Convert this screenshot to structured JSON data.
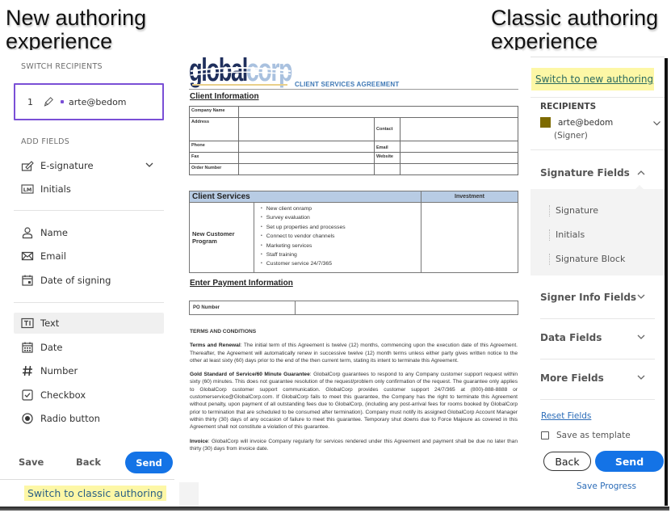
{
  "captions": {
    "new": [
      "New authoring",
      "experience"
    ],
    "classic": [
      "Classic authoring",
      "experience"
    ]
  },
  "new_authoring": {
    "switch_recipients_label": "SWITCH RECIPIENTS",
    "recipient": {
      "number": "1",
      "email": "arte@bedom",
      "color": "#7a4fd6"
    },
    "add_fields_label": "ADD FIELDS",
    "fields_group_1": [
      {
        "label": "E-signature",
        "icon": "e-signature-icon",
        "has_dropdown": true
      },
      {
        "label": "Initials",
        "icon": "initials-icon"
      }
    ],
    "fields_group_2": [
      {
        "label": "Name",
        "icon": "person-icon"
      },
      {
        "label": "Email",
        "icon": "email-icon"
      },
      {
        "label": "Date of signing",
        "icon": "calendar-icon"
      }
    ],
    "fields_group_3": [
      {
        "label": "Text",
        "icon": "text-field-icon",
        "selected": true
      },
      {
        "label": "Date",
        "icon": "date-icon"
      },
      {
        "label": "Number",
        "icon": "hash-icon"
      },
      {
        "label": "Checkbox",
        "icon": "checkbox-icon"
      },
      {
        "label": "Radio button",
        "icon": "radio-icon"
      }
    ],
    "footer": {
      "save": "Save",
      "back": "Back",
      "send": "Send"
    },
    "switch_link": "Switch to classic authoring"
  },
  "document": {
    "logo": {
      "part1": "global",
      "part2": "corp"
    },
    "title": "CLIENT SERVICES AGREEMENT",
    "client_info_heading": "Client Information",
    "client_info": {
      "company_name": "Company Name",
      "address": "Address",
      "contact": "Contact",
      "phone": "Phone",
      "email": "Email",
      "fax": "Fax",
      "website": "Website",
      "order_number": "Order Number"
    },
    "services": {
      "heading": "Client Services",
      "investment": "Investment",
      "program": "New Customer Program",
      "items": [
        "New client onramp",
        "Survey evaluation",
        "Set up properties and processes",
        "Connect to vendor channels",
        "Marketing services",
        "Staff training",
        "Customer service 24/7/365"
      ]
    },
    "payment_heading": "Enter Payment Information",
    "po_number_label": "PO Number",
    "terms": {
      "heading": "TERMS AND CONDITIONS",
      "paragraphs": [
        {
          "title": "Terms and Renewal",
          "text": ": The initial term of this Agreement is twelve (12) months, commencing upon the execution date of this Agreement. Thereafter, the Agreement will automatically renew in successive twelve (12) month terms unless either party gives written notice to the other at least sixty (60) days prior to the end of the then current term, stating its intent to terminate this Agreement."
        },
        {
          "title": "Gold Standard of Service/60 Minute Guarantee",
          "text": ": GlobalCorp guarantees to respond to any Company customer support request within sixty (60) minutes. This does not guarantee resolution of the request/problem only confirmation of the request. The guarantee only applies to GlobalCorp customer support communication. GlobalCorp provides customer support 24/7/365 at (800)-888-8888 or customerservice@GlobalCorp.com.  If GlobalCorp fails to meet this guarantee, the Company has the right to terminate this Agreement without penalty, upon payment of all outstanding fees due to GlobalCorp, (including any post-arrival fees for rooms booked by GlobalCorp prior to termination that are scheduled to be consumed after termination). Company must notify its assigned GlobalCorp Account Manager within thirty (30) days of any occasion of failure to meet this guarantee.  Temporary shut downs due to Force Majeure as covered in this Agreement shall not constitute a violation of this guarantee."
        },
        {
          "title": "Invoice",
          "text": ": GlobalCorp will invoice Company regularly for services rendered under this Agreement and payment shall be due no later than thirty (30) days from invoice date."
        }
      ]
    }
  },
  "classic_authoring": {
    "switch_link": "Switch to new authoring",
    "recipients_label": "RECIPIENTS",
    "recipient": {
      "email": "arte@bedom",
      "role": "(Signer)",
      "color": "#7d6a00"
    },
    "signature_fields": {
      "label": "Signature Fields",
      "expanded": true,
      "items": [
        "Signature",
        "Initials",
        "Signature Block"
      ]
    },
    "collapsed_sections": [
      "Signer Info Fields",
      "Data Fields",
      "More Fields"
    ],
    "reset_fields": "Reset Fields",
    "save_as_template": {
      "label": "Save as template",
      "checked": false
    },
    "back": "Back",
    "send": "Send",
    "save_progress": "Save Progress"
  },
  "colors": {
    "accent_blue": "#1473e6",
    "highlight_yellow": "#fdf7a6",
    "recipient_purple": "#7a4fd6",
    "table_header_blue": "#b8cce4"
  }
}
